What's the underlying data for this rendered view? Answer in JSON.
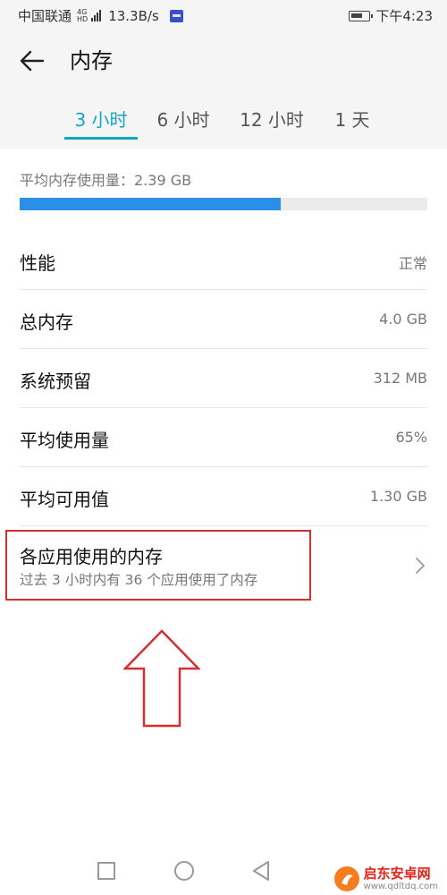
{
  "status_bar": {
    "carrier": "中国联通",
    "network_top": "4G",
    "network_bottom": "HD",
    "speed": "13.3B/s",
    "time": "下午4:23"
  },
  "header": {
    "title": "内存"
  },
  "tabs": [
    {
      "label": "3 小时",
      "active": true
    },
    {
      "label": "6 小时",
      "active": false
    },
    {
      "label": "12 小时",
      "active": false
    },
    {
      "label": "1 天",
      "active": false
    }
  ],
  "average": {
    "label": "平均内存使用量：2.39 GB",
    "usage_fraction": 0.64
  },
  "rows": [
    {
      "label": "性能",
      "value": "正常"
    },
    {
      "label": "总内存",
      "value": "4.0 GB"
    },
    {
      "label": "系统预留",
      "value": "312 MB"
    },
    {
      "label": "平均使用量",
      "value": "65%"
    },
    {
      "label": "平均可用值",
      "value": "1.30 GB"
    }
  ],
  "apps_memory": {
    "title": "各应用使用的内存",
    "subtitle": "过去 3 小时内有 36 个应用使用了内存"
  },
  "watermark": {
    "name": "启东安卓网",
    "url": "www.qdltdq.com"
  },
  "colors": {
    "accent": "#13a5c7",
    "progress": "#2a8fe6",
    "annotation": "#d32f2f"
  },
  "icons": {
    "back": "arrow-left-icon",
    "chevron": "chevron-right-icon",
    "nav_recent": "square-icon",
    "nav_home": "circle-icon",
    "nav_back": "triangle-icon"
  }
}
